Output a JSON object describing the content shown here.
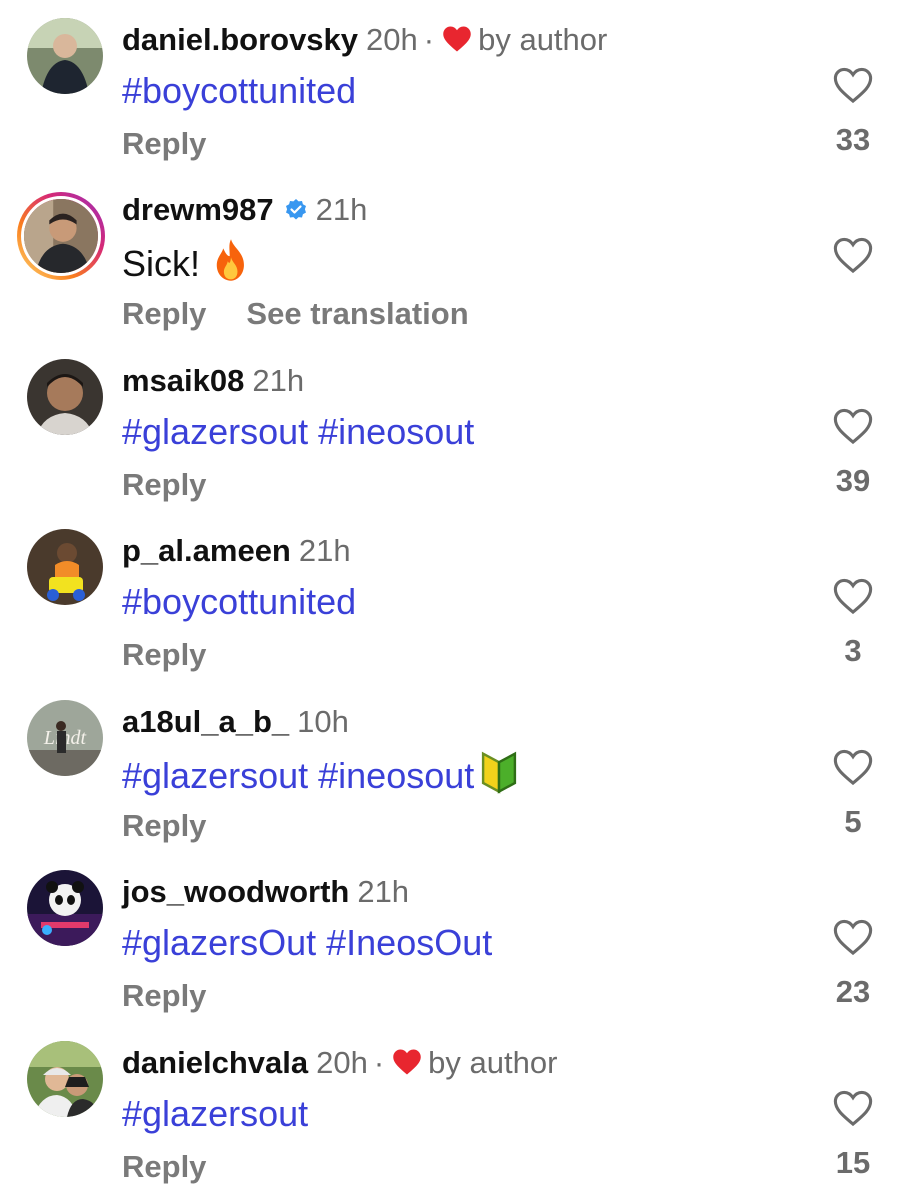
{
  "comments": [
    {
      "username": "daniel.borovsky",
      "time": "20h",
      "dot": "·",
      "liked_by_author": true,
      "by_author_label": "by author",
      "text_parts": [
        "#boycottunited"
      ],
      "reply_label": "Reply",
      "likes": "33",
      "avatar": "avatar-man-suit"
    },
    {
      "username": "drewm987",
      "time": "21h",
      "verified": true,
      "text": "Sick!",
      "emoji": "fire-emoji",
      "reply_label": "Reply",
      "see_translation_label": "See translation",
      "likes": "",
      "avatar": "avatar-man-story-ring"
    },
    {
      "username": "msaik08",
      "time": "21h",
      "text_parts": [
        "#glazersout",
        "#ineosout"
      ],
      "reply_label": "Reply",
      "likes": "39",
      "avatar": "avatar-man-dark"
    },
    {
      "username": "p_al.ameen",
      "time": "21h",
      "text_parts": [
        "#boycottunited"
      ],
      "reply_label": "Reply",
      "likes": "3",
      "avatar": "avatar-person-yellow"
    },
    {
      "username": "a18ul_a_b_",
      "time": "10h",
      "text_parts": [
        "#glazersout",
        "#ineosout"
      ],
      "emoji": "beginner-emoji",
      "reply_label": "Reply",
      "likes": "5",
      "avatar": "avatar-person-sign"
    },
    {
      "username": "jos_woodworth",
      "time": "21h",
      "text_parts": [
        "#glazersOut",
        "#IneosOut"
      ],
      "reply_label": "Reply",
      "likes": "23",
      "avatar": "avatar-panda"
    },
    {
      "username": "danielchvala",
      "time": "20h",
      "dot": "·",
      "liked_by_author": true,
      "by_author_label": "by author",
      "text_parts": [
        "#glazersout"
      ],
      "reply_label": "Reply",
      "likes": "15",
      "avatar": "avatar-two-people"
    }
  ],
  "colors": {
    "hashtag": "#3a40d8",
    "liked_heart": "#e8262f",
    "verified": "#3897f0",
    "secondary_text": "#6b6b6b"
  }
}
